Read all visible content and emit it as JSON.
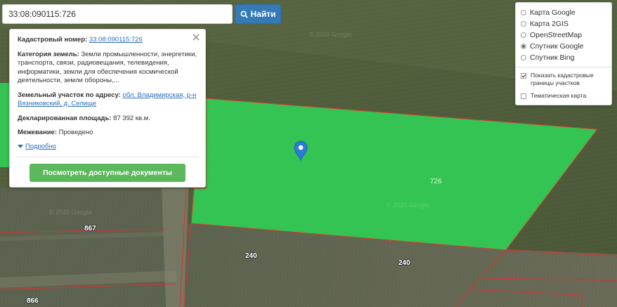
{
  "search": {
    "value": "33:08:090115:726",
    "button_label": "Найти"
  },
  "info": {
    "cadastral_label": "Кадастровый номер:",
    "cadastral_value": "33:08:090115:726",
    "category_label": "Категория земель:",
    "category_value": "Земли промышленности, энергетики, транспорта, связи, радиовещания, телевидения, информатики, земли для обеспечения космической деятельности, земли обороны,...",
    "address_label": "Земельный участок по адресу:",
    "address_value": "обл. Владимирская, р-н Вязниковский, д. Селище",
    "area_label": "Декларированная площадь:",
    "area_value": "87 392 кв.м.",
    "survey_label": "Межевание:",
    "survey_value": "Проведено",
    "more_label": "Подробно",
    "docs_button": "Посмотреть доступные документы"
  },
  "layers": {
    "base_options": [
      {
        "label": "Карта Google",
        "selected": false
      },
      {
        "label": "Карта 2GIS",
        "selected": false
      },
      {
        "label": "OpenStreetMap",
        "selected": false
      },
      {
        "label": "Спутник Google",
        "selected": true
      },
      {
        "label": "Спутник Bing",
        "selected": false
      }
    ],
    "overlays": [
      {
        "label": "Показать кадастровые границы участков",
        "checked": true
      },
      {
        "label": "Тематическая карта",
        "checked": false
      }
    ]
  },
  "map": {
    "parcel_labels": [
      "726",
      "867",
      "240",
      "240",
      "866"
    ],
    "watermark": "© 2020 Google",
    "colors": {
      "parcel_fill": "#33cc55",
      "border": "#e03030",
      "marker": "#2f7bd8",
      "primary_button": "#337ab7",
      "success_button": "#5cb85c"
    },
    "icons": [
      "search-icon",
      "close-icon",
      "map-marker-icon",
      "caret-down-icon"
    ]
  }
}
